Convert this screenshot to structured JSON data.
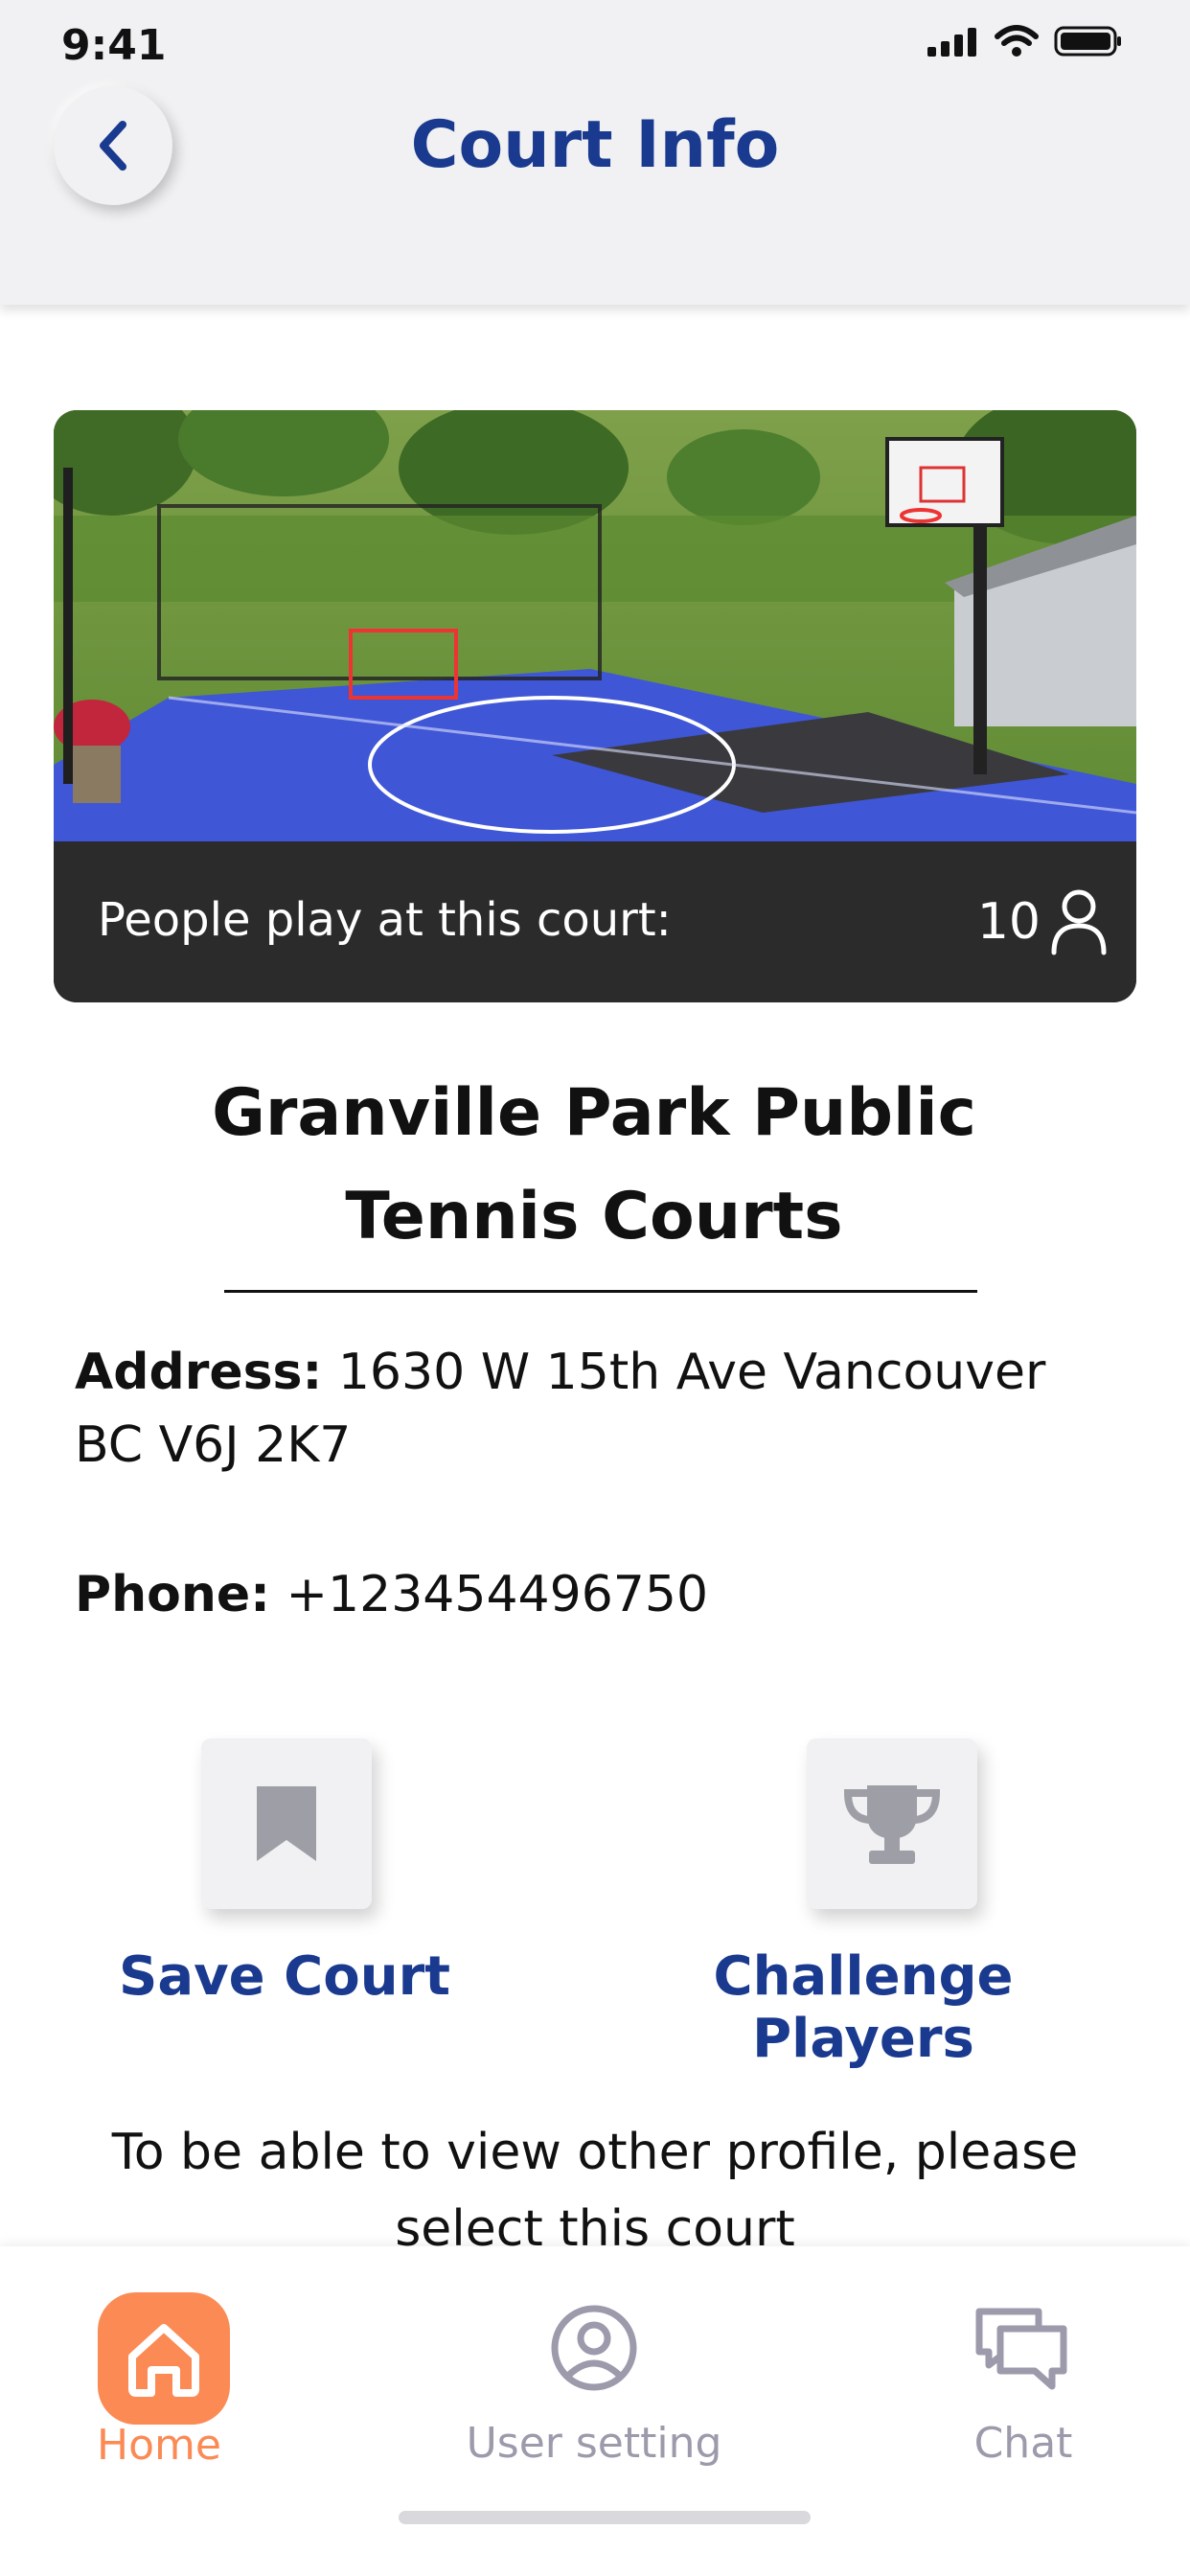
{
  "status_bar": {
    "time": "9:41"
  },
  "header": {
    "title": "Court Info"
  },
  "court": {
    "people_label": "People play at this court:",
    "people_count": "10",
    "name_line1": "Granville Park Public",
    "name_line2": "Tennis Courts",
    "address_label": "Address:",
    "address_value": "1630 W 15th Ave Vancouver BC V6J 2K7",
    "phone_label": "Phone:",
    "phone_value": "+123454496750"
  },
  "actions": {
    "save_label": "Save Court",
    "challenge_label": "Challenge Players"
  },
  "hint": "To be able to view other profile, please select this court",
  "tabbar": {
    "home": "Home",
    "user_setting": "User setting",
    "chat": "Chat"
  },
  "colors": {
    "accent_blue": "#1a3a8f",
    "active_orange": "#fb8a55",
    "inactive_gray": "#9c9aab"
  },
  "icons": [
    "back-chevron-icon",
    "signal-icon",
    "wifi-icon",
    "battery-icon",
    "person-icon",
    "bookmark-icon",
    "trophy-icon",
    "home-icon",
    "user-circle-icon",
    "chat-bubbles-icon"
  ]
}
